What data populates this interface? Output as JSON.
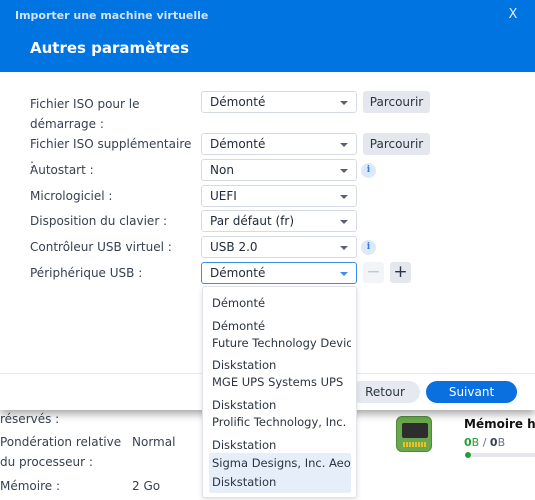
{
  "background": {
    "rows": [
      {
        "label": "réservés :",
        "value": ""
      },
      {
        "label": "Pondération relative du processeur :",
        "value": "Normal"
      },
      {
        "label": "Mémoire :",
        "value": "2 Go"
      }
    ],
    "memory_card": {
      "icon": "memory-chip-icon",
      "title": "Mémoire hôte",
      "used": "0",
      "used_unit": "B",
      "separator": " / ",
      "total": "0",
      "total_unit": "B",
      "usage_fraction": 0.0,
      "accent_color": "#22a033"
    }
  },
  "dialog": {
    "window_title": "Importer une machine virtuelle",
    "close_icon": "close-icon",
    "close_glyph": "X",
    "title": "Autres paramètres",
    "header_color": "#0074e1",
    "fields": [
      {
        "label": "Fichier ISO pour le démarrage :",
        "value": "Démonté",
        "button": "Parcourir"
      },
      {
        "label": "Fichier ISO supplémentaire :",
        "value": "Démonté",
        "button": "Parcourir"
      },
      {
        "label": "Autostart :",
        "value": "Non",
        "info": "i"
      },
      {
        "label": "Micrologiciel :",
        "value": "UEFI"
      },
      {
        "label": "Disposition du clavier :",
        "value": "Par défaut (fr)"
      },
      {
        "label": "Contrôleur USB virtuel :",
        "value": "USB 2.0",
        "info": "i"
      },
      {
        "label": "Périphérique USB :",
        "value": "Démonté",
        "minus": "−",
        "plus": "+"
      }
    ],
    "footer": {
      "back_label": "Retour",
      "next_label": "Suivant",
      "primary_color": "#0a70e0"
    },
    "usb_dropdown": {
      "options": [
        {
          "line1": "Démonté",
          "line2": ""
        },
        {
          "line1": "Démonté",
          "line2": "Future Technology Devices"
        },
        {
          "line1": "Diskstation",
          "line2": "MGE UPS Systems UPS"
        },
        {
          "line1": "Diskstation",
          "line2": "Prolific Technology, Inc. PL"
        },
        {
          "line1": "Diskstation",
          "line2": "Sigma Designs, Inc. Aeote"
        },
        {
          "line1": "Diskstation",
          "line2": ""
        }
      ],
      "highlighted_text": [
        "Sigma Designs, Inc. Aeote",
        "Diskstation"
      ]
    }
  }
}
